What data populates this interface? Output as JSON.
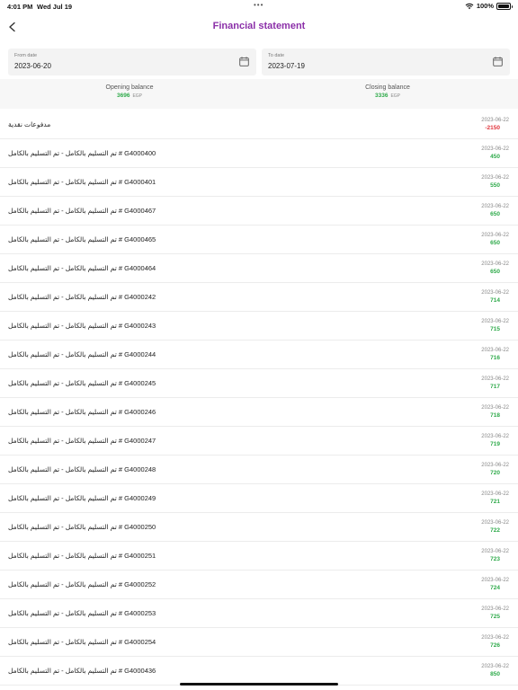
{
  "status_bar": {
    "time": "4:01 PM",
    "date": "Wed Jul 19",
    "dots": "•••",
    "battery": "100%",
    "icons": [
      "wifi-icon",
      "battery-icon"
    ]
  },
  "header": {
    "title": "Financial statement",
    "back_icon": "chevron-left-icon"
  },
  "filters": {
    "from_label": "From date",
    "from_value": "2023-06-20",
    "to_label": "To date",
    "to_value": "2023-07-19",
    "icon": "calendar-icon"
  },
  "balances": {
    "opening_label": "Opening balance",
    "opening_amount": "3696",
    "closing_label": "Closing balance",
    "closing_amount": "3336",
    "currency": "EGP"
  },
  "colors": {
    "accent": "#8b2fa8",
    "positive": "#2eaa4a",
    "negative": "#e0323a"
  },
  "transactions": [
    {
      "desc": "مدفوعات نقدية",
      "date": "2023-06-22",
      "amount": "-2150",
      "type": "neg"
    },
    {
      "desc": "تم التسليم بالكامل - تم التسليم بالكامل # G4000400",
      "date": "2023-06-22",
      "amount": "450",
      "type": "pos"
    },
    {
      "desc": "تم التسليم بالكامل - تم التسليم بالكامل # G4000401",
      "date": "2023-06-22",
      "amount": "550",
      "type": "pos"
    },
    {
      "desc": "تم التسليم بالكامل - تم التسليم بالكامل # G4000467",
      "date": "2023-06-22",
      "amount": "650",
      "type": "pos"
    },
    {
      "desc": "تم التسليم بالكامل - تم التسليم بالكامل # G4000465",
      "date": "2023-06-22",
      "amount": "650",
      "type": "pos"
    },
    {
      "desc": "تم التسليم بالكامل - تم التسليم بالكامل # G4000464",
      "date": "2023-06-22",
      "amount": "650",
      "type": "pos"
    },
    {
      "desc": "تم التسليم بالكامل - تم التسليم بالكامل # G4000242",
      "date": "2023-06-22",
      "amount": "714",
      "type": "pos"
    },
    {
      "desc": "تم التسليم بالكامل - تم التسليم بالكامل # G4000243",
      "date": "2023-06-22",
      "amount": "715",
      "type": "pos"
    },
    {
      "desc": "تم التسليم بالكامل - تم التسليم بالكامل # G4000244",
      "date": "2023-06-22",
      "amount": "716",
      "type": "pos"
    },
    {
      "desc": "تم التسليم بالكامل - تم التسليم بالكامل # G4000245",
      "date": "2023-06-22",
      "amount": "717",
      "type": "pos"
    },
    {
      "desc": "تم التسليم بالكامل - تم التسليم بالكامل # G4000246",
      "date": "2023-06-22",
      "amount": "718",
      "type": "pos"
    },
    {
      "desc": "تم التسليم بالكامل - تم التسليم بالكامل # G4000247",
      "date": "2023-06-22",
      "amount": "719",
      "type": "pos"
    },
    {
      "desc": "تم التسليم بالكامل - تم التسليم بالكامل # G4000248",
      "date": "2023-06-22",
      "amount": "720",
      "type": "pos"
    },
    {
      "desc": "تم التسليم بالكامل - تم التسليم بالكامل # G4000249",
      "date": "2023-06-22",
      "amount": "721",
      "type": "pos"
    },
    {
      "desc": "تم التسليم بالكامل - تم التسليم بالكامل # G4000250",
      "date": "2023-06-22",
      "amount": "722",
      "type": "pos"
    },
    {
      "desc": "تم التسليم بالكامل - تم التسليم بالكامل # G4000251",
      "date": "2023-06-22",
      "amount": "723",
      "type": "pos"
    },
    {
      "desc": "تم التسليم بالكامل - تم التسليم بالكامل # G4000252",
      "date": "2023-06-22",
      "amount": "724",
      "type": "pos"
    },
    {
      "desc": "تم التسليم بالكامل - تم التسليم بالكامل # G4000253",
      "date": "2023-06-22",
      "amount": "725",
      "type": "pos"
    },
    {
      "desc": "تم التسليم بالكامل - تم التسليم بالكامل # G4000254",
      "date": "2023-06-22",
      "amount": "726",
      "type": "pos"
    },
    {
      "desc": "تم التسليم بالكامل - تم التسليم بالكامل # G4000436",
      "date": "2023-06-22",
      "amount": "850",
      "type": "pos"
    }
  ]
}
